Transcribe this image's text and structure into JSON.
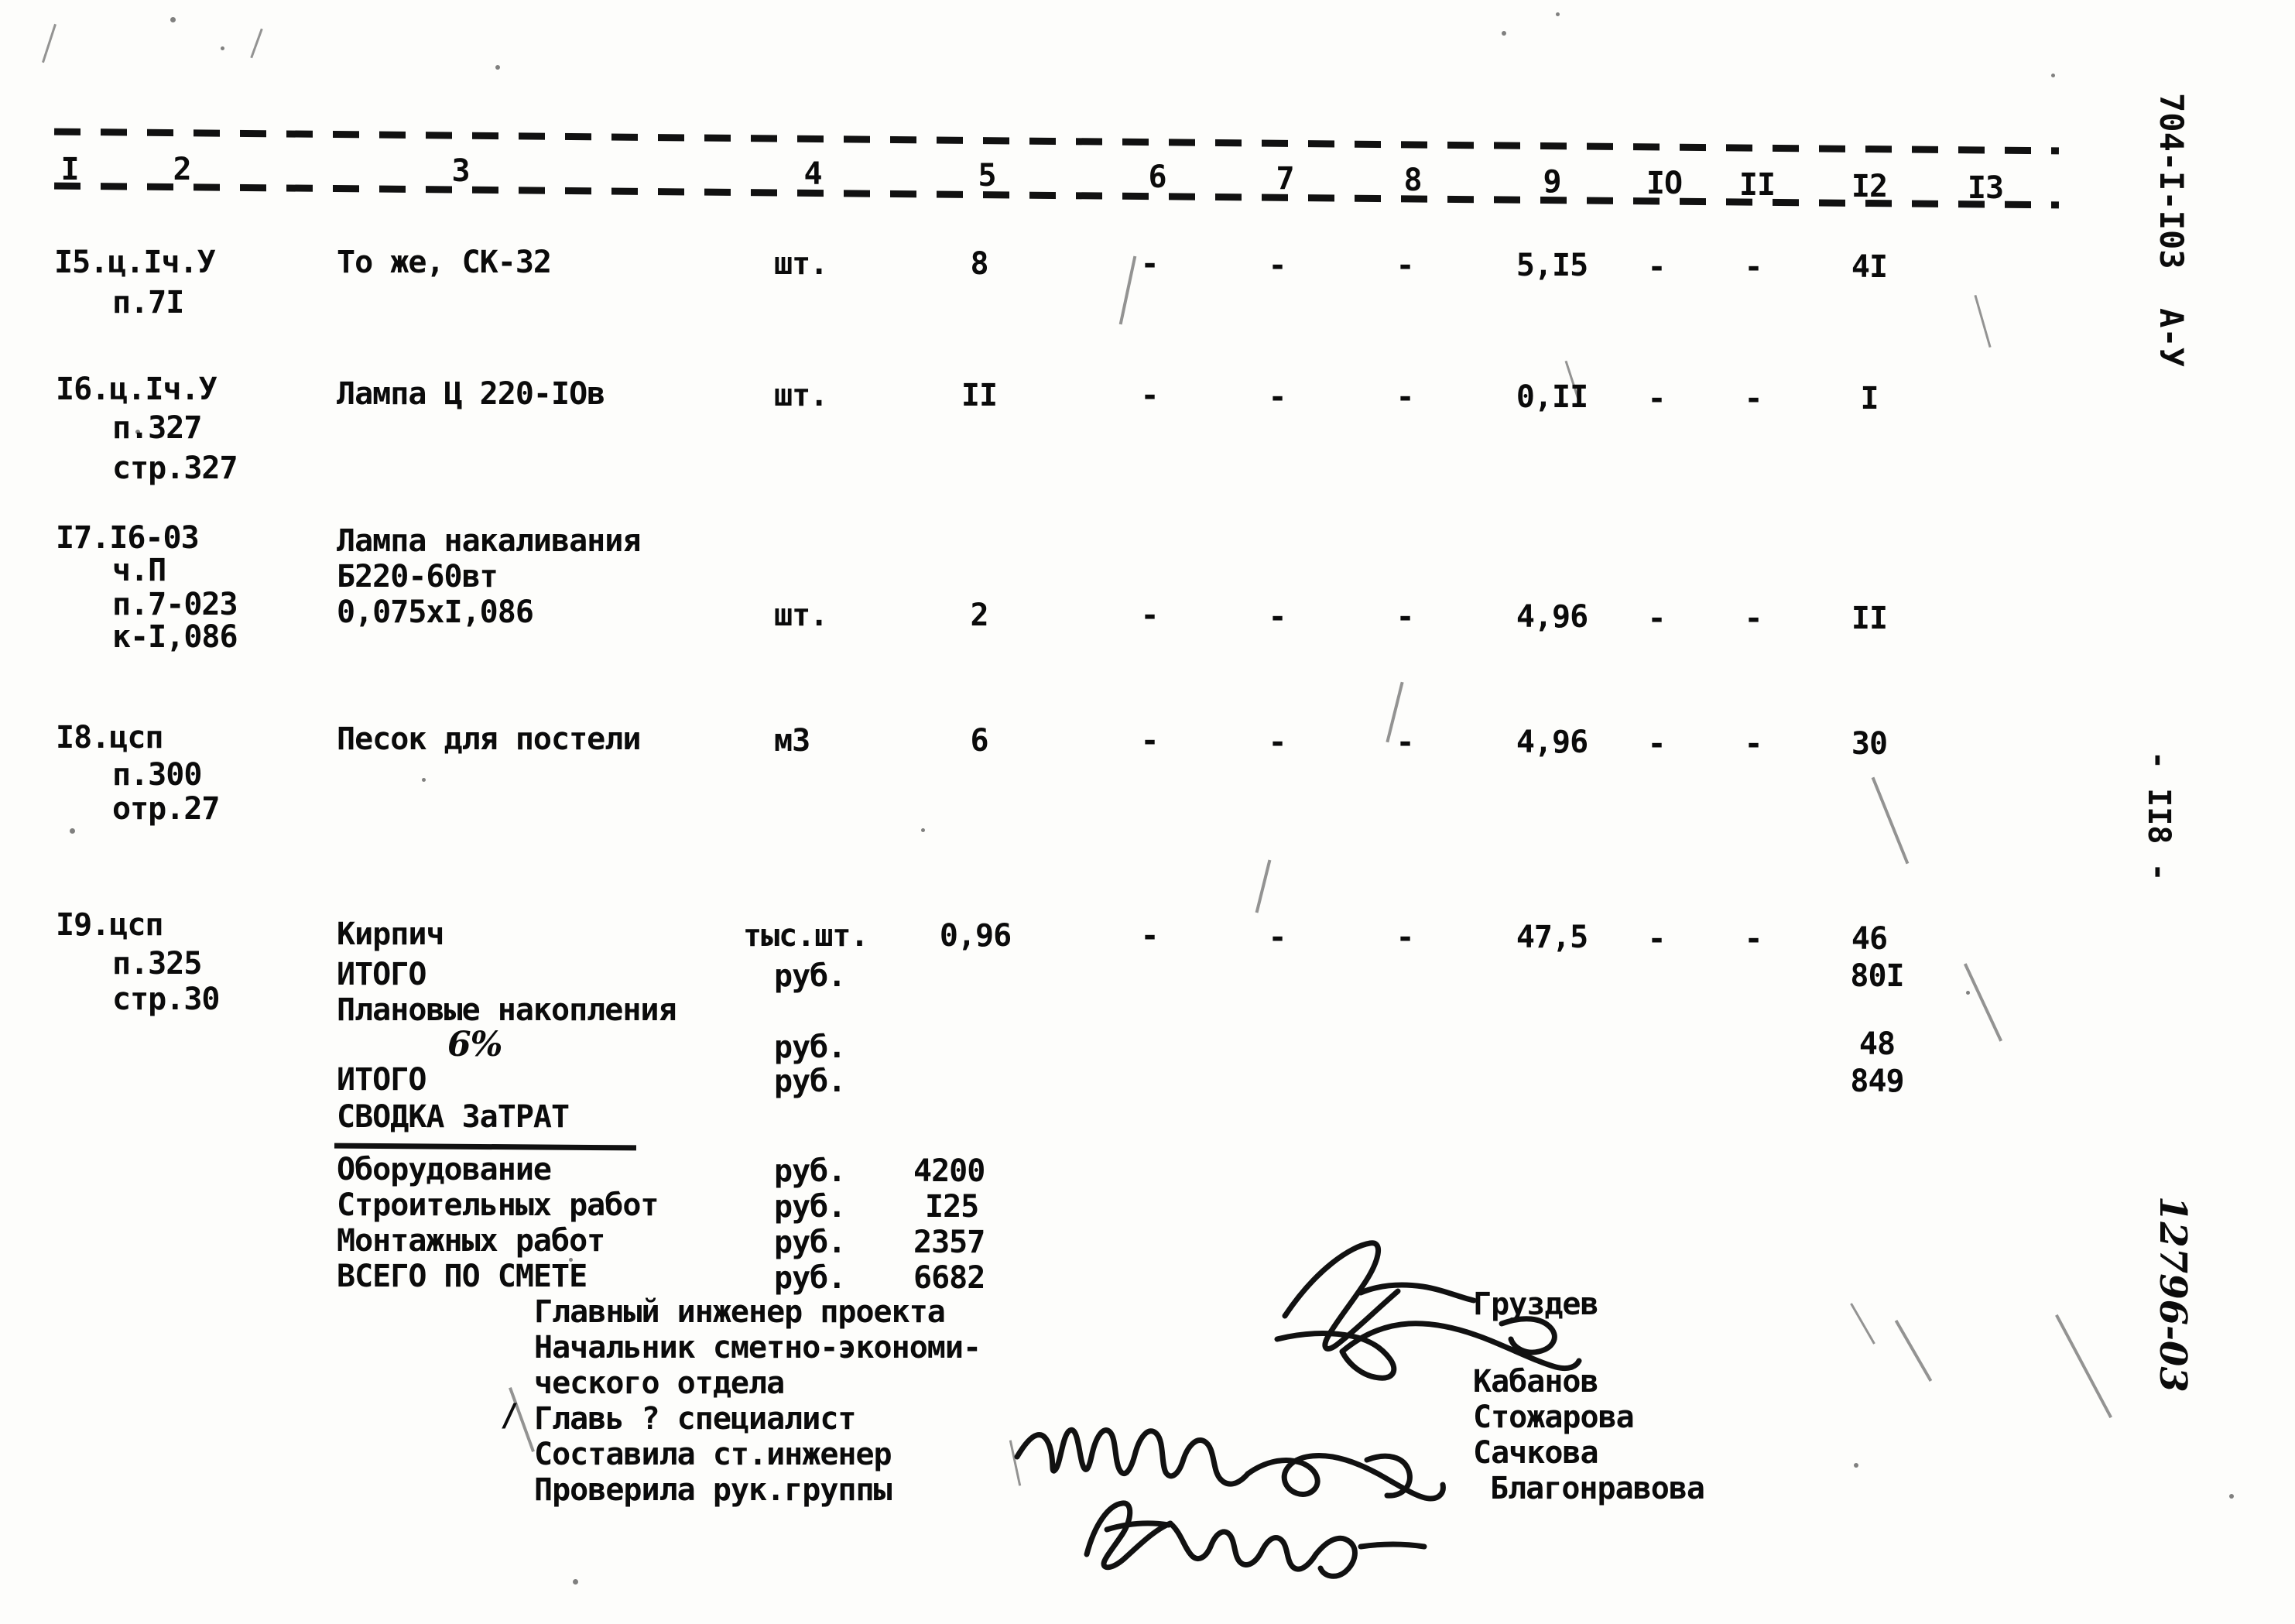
{
  "document": {
    "margin_code": "704-I-I03  А-У",
    "page_number": "- II8 -",
    "archive_number": "12796-03"
  },
  "table": {
    "column_headers": [
      "I",
      "2",
      "3",
      "4",
      "5",
      "6",
      "7",
      "8",
      "9",
      "IO",
      "II",
      "I2",
      "I3"
    ],
    "rows": [
      {
        "code_lines": [
          "I5.ц.Iч.У",
          "п.7I"
        ],
        "name_lines": [
          "То же, СК-32"
        ],
        "unit": "шт.",
        "qty": "8",
        "c6": "-",
        "c7": "-",
        "c8": "-",
        "c9": "5,I5",
        "c10": "-",
        "c11": "-",
        "c12": "4I",
        "c13": ""
      },
      {
        "code_lines": [
          "I6.ц.Iч.У",
          "п.327",
          "стр.327"
        ],
        "name_lines": [
          "Лампа Ц 220-IОв"
        ],
        "unit": "шт.",
        "qty": "II",
        "c6": "-",
        "c7": "-",
        "c8": "-",
        "c9": "0,II",
        "c10": "-",
        "c11": "-",
        "c12": "I",
        "c13": ""
      },
      {
        "code_lines": [
          "I7.I6-03",
          "ч.П",
          "п.7-023",
          "к-I,086"
        ],
        "name_lines": [
          "Лампа накаливания",
          "Б220-60вт",
          "0,075хI,086"
        ],
        "unit": "шт.",
        "qty": "2",
        "c6": "-",
        "c7": "-",
        "c8": "-",
        "c9": "4,96",
        "c10": "-",
        "c11": "-",
        "c12": "II",
        "c13": ""
      },
      {
        "code_lines": [
          "I8.цсп",
          "п.300",
          "отр.27"
        ],
        "name_lines": [
          "Песок для постели"
        ],
        "unit": "м3",
        "qty": "6",
        "c6": "-",
        "c7": "-",
        "c8": "-",
        "c9": "4,96",
        "c10": "-",
        "c11": "-",
        "c12": "30",
        "c13": ""
      },
      {
        "code_lines": [
          "I9.цсп",
          "п.325",
          "стр.30"
        ],
        "name_lines": [
          "Кирпич"
        ],
        "unit": "тыс.шт.",
        "qty": "0,96",
        "c6": "-",
        "c7": "-",
        "c8": "-",
        "c9": "47,5",
        "c10": "-",
        "c11": "-",
        "c12": "46",
        "c13": ""
      }
    ]
  },
  "totals": {
    "itogo_1_label": "ИТОГО",
    "itogo_1_unit": "руб.",
    "itogo_1_value": "80I",
    "overhead_label": "Плановые накопления",
    "overhead_percent": "6%",
    "overhead_unit": "руб.",
    "overhead_value": "48",
    "itogo_2_label": "ИТОГО",
    "itogo_2_unit": "руб.",
    "itogo_2_value": "849"
  },
  "summary": {
    "title": "СВОДКА ЗаТРАТ",
    "lines": [
      {
        "label": "Оборудование",
        "unit": "руб.",
        "value": "4200"
      },
      {
        "label": "Строительных работ",
        "unit": "руб.",
        "value": "I25"
      },
      {
        "label": "Монтажных работ",
        "unit": "руб.",
        "value": "2357"
      },
      {
        "label": "ВСЕГО ПО СМЕТЕ",
        "unit": "руб.",
        "value": "6682"
      }
    ]
  },
  "signatures": {
    "roles": [
      "Главный инженер проекта",
      "Начальник сметно-экономи-",
      "ческого отдела",
      "Главь ? специалист",
      "Составила ст.инженер",
      "Проверила рук.группы"
    ],
    "names": [
      "Груздев",
      "Кабанов",
      "Стожарова",
      "Сачкова",
      "Благонравова"
    ]
  }
}
